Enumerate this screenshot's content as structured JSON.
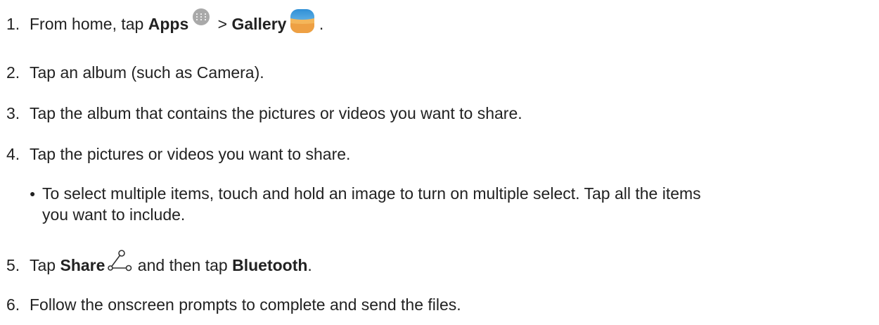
{
  "steps": [
    {
      "number": "1.",
      "pre": "From home, tap ",
      "bold1": "Apps",
      "icon1": "apps-grid-icon",
      "mid": " > ",
      "bold2": "Gallery",
      "icon2": "gallery-icon",
      "post": " ."
    },
    {
      "number": "2.",
      "text": "Tap an album (such as Camera)."
    },
    {
      "number": "3.",
      "text": "Tap the album that contains the pictures or videos you want to share."
    },
    {
      "number": "4.",
      "text": "Tap the pictures or videos you want to share."
    },
    {
      "number": "5.",
      "pre": "Tap ",
      "bold1": "Share",
      "icon1": "share-icon",
      "mid": " and then tap ",
      "bold2": "Bluetooth",
      "post": "."
    },
    {
      "number": "6.",
      "text": "Follow the onscreen prompts to complete and send the files."
    }
  ],
  "bullet": {
    "line1": "To select multiple items, touch and hold an image to turn on multiple select. Tap all the items",
    "line2": "you want to include."
  },
  "colors": {
    "text": "#222222",
    "apps_icon": "#a9a9a9",
    "gallery_sky": "#4aa3df",
    "gallery_sand": "#f0a94a"
  }
}
